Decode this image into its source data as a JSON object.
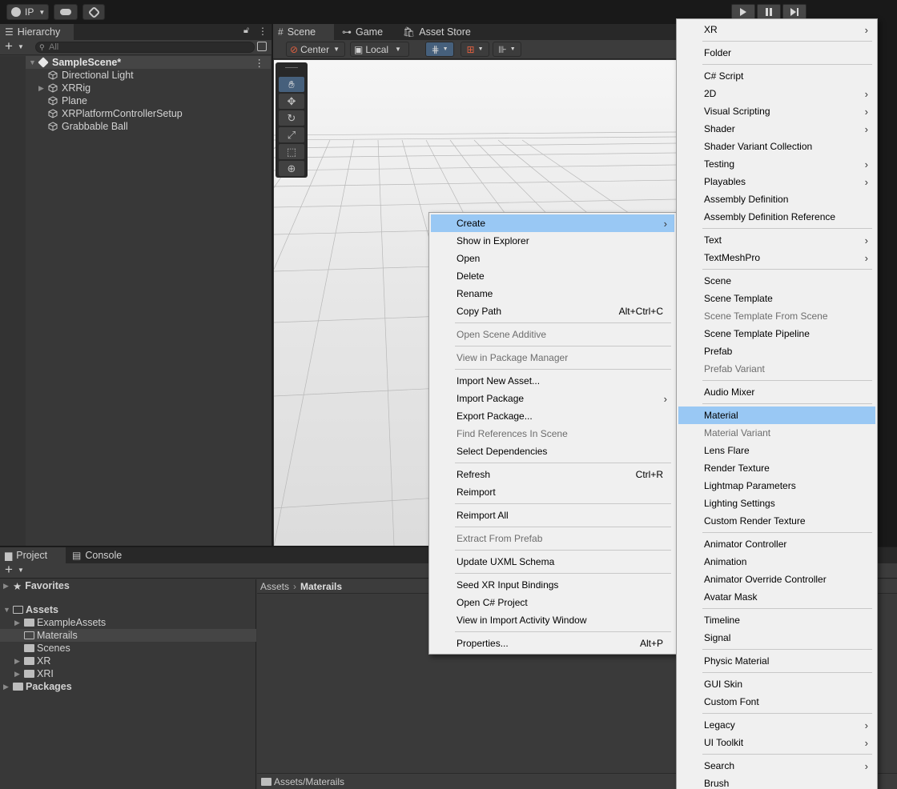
{
  "toolbar": {
    "account": "IP"
  },
  "hierarchy": {
    "tab": "Hierarchy",
    "search_placeholder": "All",
    "scene_name": "SampleScene*",
    "items": [
      "Directional Light",
      "XRRig",
      "Plane",
      "XRPlatformControllerSetup",
      "Grabbable Ball"
    ]
  },
  "scene": {
    "tabs": [
      "Scene",
      "Game",
      "Asset Store"
    ],
    "pivot": "Center",
    "space": "Local"
  },
  "project": {
    "tabs": [
      "Project",
      "Console"
    ],
    "favorites": "Favorites",
    "assets": "Assets",
    "folders": [
      "ExampleAssets",
      "Materails",
      "Scenes",
      "XR",
      "XRI"
    ],
    "packages": "Packages",
    "breadcrumb": [
      "Assets",
      "Materails"
    ],
    "path": "Assets/Materails"
  },
  "context_menu": {
    "items": [
      {
        "label": "Create",
        "submenu": true,
        "highlight": true
      },
      {
        "label": "Show in Explorer"
      },
      {
        "label": "Open"
      },
      {
        "label": "Delete"
      },
      {
        "label": "Rename"
      },
      {
        "label": "Copy Path",
        "shortcut": "Alt+Ctrl+C"
      },
      {
        "separator": true
      },
      {
        "label": "Open Scene Additive",
        "disabled": true
      },
      {
        "separator": true
      },
      {
        "label": "View in Package Manager",
        "disabled": true
      },
      {
        "separator": true
      },
      {
        "label": "Import New Asset..."
      },
      {
        "label": "Import Package",
        "submenu": true
      },
      {
        "label": "Export Package..."
      },
      {
        "label": "Find References In Scene",
        "disabled": true
      },
      {
        "label": "Select Dependencies"
      },
      {
        "separator": true
      },
      {
        "label": "Refresh",
        "shortcut": "Ctrl+R"
      },
      {
        "label": "Reimport"
      },
      {
        "separator": true
      },
      {
        "label": "Reimport All"
      },
      {
        "separator": true
      },
      {
        "label": "Extract From Prefab",
        "disabled": true
      },
      {
        "separator": true
      },
      {
        "label": "Update UXML Schema"
      },
      {
        "separator": true
      },
      {
        "label": "Seed XR Input Bindings"
      },
      {
        "label": "Open C# Project"
      },
      {
        "label": "View in Import Activity Window"
      },
      {
        "separator": true
      },
      {
        "label": "Properties...",
        "shortcut": "Alt+P"
      }
    ]
  },
  "create_menu": {
    "items": [
      {
        "label": "XR",
        "submenu": true
      },
      {
        "separator": true
      },
      {
        "label": "Folder"
      },
      {
        "separator": true
      },
      {
        "label": "C# Script"
      },
      {
        "label": "2D",
        "submenu": true
      },
      {
        "label": "Visual Scripting",
        "submenu": true
      },
      {
        "label": "Shader",
        "submenu": true
      },
      {
        "label": "Shader Variant Collection"
      },
      {
        "label": "Testing",
        "submenu": true
      },
      {
        "label": "Playables",
        "submenu": true
      },
      {
        "label": "Assembly Definition"
      },
      {
        "label": "Assembly Definition Reference"
      },
      {
        "separator": true
      },
      {
        "label": "Text",
        "submenu": true
      },
      {
        "label": "TextMeshPro",
        "submenu": true
      },
      {
        "separator": true
      },
      {
        "label": "Scene"
      },
      {
        "label": "Scene Template"
      },
      {
        "label": "Scene Template From Scene",
        "disabled": true
      },
      {
        "label": "Scene Template Pipeline"
      },
      {
        "label": "Prefab"
      },
      {
        "label": "Prefab Variant",
        "disabled": true
      },
      {
        "separator": true
      },
      {
        "label": "Audio Mixer"
      },
      {
        "separator": true
      },
      {
        "label": "Material",
        "highlight": true
      },
      {
        "label": "Material Variant",
        "disabled": true
      },
      {
        "label": "Lens Flare"
      },
      {
        "label": "Render Texture"
      },
      {
        "label": "Lightmap Parameters"
      },
      {
        "label": "Lighting Settings"
      },
      {
        "label": "Custom Render Texture"
      },
      {
        "separator": true
      },
      {
        "label": "Animator Controller"
      },
      {
        "label": "Animation"
      },
      {
        "label": "Animator Override Controller"
      },
      {
        "label": "Avatar Mask"
      },
      {
        "separator": true
      },
      {
        "label": "Timeline"
      },
      {
        "label": "Signal"
      },
      {
        "separator": true
      },
      {
        "label": "Physic Material"
      },
      {
        "separator": true
      },
      {
        "label": "GUI Skin"
      },
      {
        "label": "Custom Font"
      },
      {
        "separator": true
      },
      {
        "label": "Legacy",
        "submenu": true
      },
      {
        "label": "UI Toolkit",
        "submenu": true
      },
      {
        "separator": true
      },
      {
        "label": "Search",
        "submenu": true
      },
      {
        "label": "Brush"
      }
    ]
  }
}
